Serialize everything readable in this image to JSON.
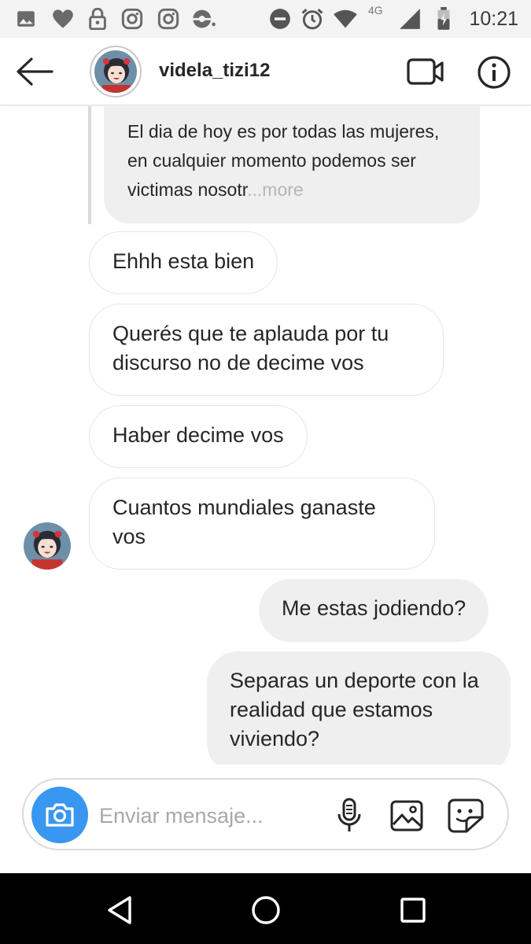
{
  "status_bar": {
    "time": "10:21",
    "network": "4G",
    "icons": [
      "image-icon",
      "heart-icon",
      "lock-icon",
      "instagram-icon",
      "instagram-icon",
      "pokeball-icon",
      "do-not-disturb-icon",
      "alarm-icon",
      "wifi-icon",
      "cell-signal-icon",
      "battery-icon"
    ]
  },
  "header": {
    "username": "videla_tizi12",
    "icons": [
      "back-arrow-icon",
      "video-call-icon",
      "info-icon"
    ]
  },
  "messages": [
    {
      "side": "in",
      "quoted": true,
      "text": "El dia de hoy es por todas las mujeres, en cualquier momento podemos ser victimas nosotr",
      "ellipsis": "...",
      "more": "more"
    },
    {
      "side": "in",
      "text": "Ehhh esta bien"
    },
    {
      "side": "in",
      "text": "Querés que te aplauda por tu discurso no de decime vos"
    },
    {
      "side": "in",
      "text": "Haber decime vos"
    },
    {
      "side": "in",
      "text": "Cuantos mundiales ganaste vos"
    },
    {
      "side": "out",
      "text": "Me estas jodiendo?"
    },
    {
      "side": "out",
      "text": "Separas un deporte con la realidad que estamos viviendo?"
    }
  ],
  "composer": {
    "placeholder": "Enviar mensaje...",
    "icons": [
      "camera-icon",
      "microphone-icon",
      "gallery-icon",
      "sticker-icon"
    ],
    "camera_color": "#3897f0"
  },
  "nav_bar": {
    "icons": [
      "back-triangle-icon",
      "home-circle-icon",
      "recents-square-icon"
    ]
  }
}
